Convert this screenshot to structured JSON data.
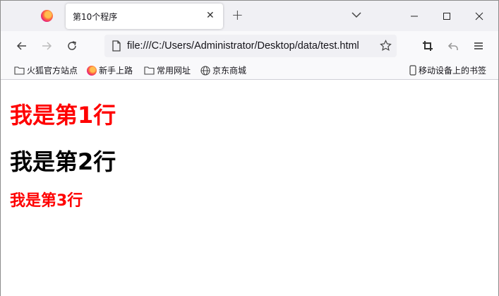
{
  "browser": {
    "tab": {
      "title": "第10个程序",
      "close_glyph": "✕"
    },
    "new_tab_glyph": "+",
    "address": {
      "url": "file:///C:/Users/Administrator/Desktop/data/test.html"
    },
    "bookmarks": [
      {
        "label": "火狐官方站点",
        "icon": "folder-icon"
      },
      {
        "label": "新手上路",
        "icon": "firefox-icon"
      },
      {
        "label": "常用网址",
        "icon": "folder-icon"
      },
      {
        "label": "京东商城",
        "icon": "globe-icon"
      }
    ],
    "mobile_bookmarks": {
      "label": "移动设备上的书签",
      "icon": "mobile-icon"
    }
  },
  "page": {
    "lines": [
      {
        "text": "我是第1行",
        "color": "#ff0000"
      },
      {
        "text": "我是第2行",
        "color": "#000000"
      },
      {
        "text": "我是第3行",
        "color": "#ff0000"
      }
    ]
  }
}
